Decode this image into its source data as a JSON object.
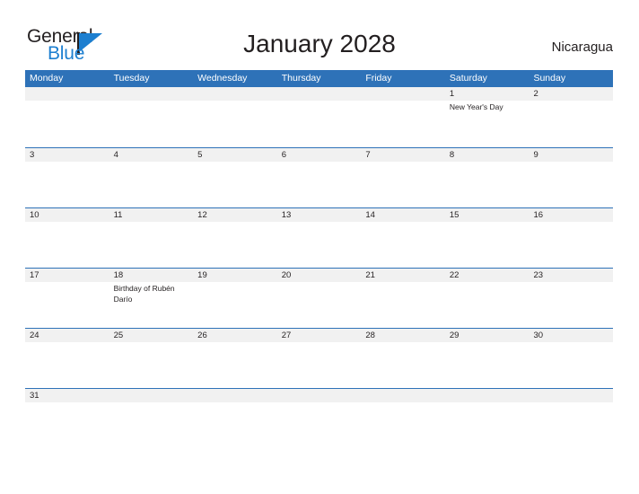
{
  "brand": {
    "word_one": "General",
    "word_two": "Blue",
    "flag_icon": "triangle-flag-icon",
    "accent_blue": "#1d7fd0"
  },
  "header": {
    "title": "January 2028",
    "country": "Nicaragua"
  },
  "colors": {
    "header_blue": "#2e72b8",
    "band_gray": "#f1f1f1",
    "text": "#231f20",
    "page_background": "#ffffff"
  },
  "calendar": {
    "month": "January",
    "year": "2028",
    "day_headers": [
      "Monday",
      "Tuesday",
      "Wednesday",
      "Thursday",
      "Friday",
      "Saturday",
      "Sunday"
    ],
    "weeks": [
      [
        {
          "date": "",
          "events": []
        },
        {
          "date": "",
          "events": []
        },
        {
          "date": "",
          "events": []
        },
        {
          "date": "",
          "events": []
        },
        {
          "date": "",
          "events": []
        },
        {
          "date": "1",
          "events": [
            "New Year's Day"
          ]
        },
        {
          "date": "2",
          "events": []
        }
      ],
      [
        {
          "date": "3",
          "events": []
        },
        {
          "date": "4",
          "events": []
        },
        {
          "date": "5",
          "events": []
        },
        {
          "date": "6",
          "events": []
        },
        {
          "date": "7",
          "events": []
        },
        {
          "date": "8",
          "events": []
        },
        {
          "date": "9",
          "events": []
        }
      ],
      [
        {
          "date": "10",
          "events": []
        },
        {
          "date": "11",
          "events": []
        },
        {
          "date": "12",
          "events": []
        },
        {
          "date": "13",
          "events": []
        },
        {
          "date": "14",
          "events": []
        },
        {
          "date": "15",
          "events": []
        },
        {
          "date": "16",
          "events": []
        }
      ],
      [
        {
          "date": "17",
          "events": []
        },
        {
          "date": "18",
          "events": [
            "Birthday of Rubén Darío"
          ]
        },
        {
          "date": "19",
          "events": []
        },
        {
          "date": "20",
          "events": []
        },
        {
          "date": "21",
          "events": []
        },
        {
          "date": "22",
          "events": []
        },
        {
          "date": "23",
          "events": []
        }
      ],
      [
        {
          "date": "24",
          "events": []
        },
        {
          "date": "25",
          "events": []
        },
        {
          "date": "26",
          "events": []
        },
        {
          "date": "27",
          "events": []
        },
        {
          "date": "28",
          "events": []
        },
        {
          "date": "29",
          "events": []
        },
        {
          "date": "30",
          "events": []
        }
      ],
      [
        {
          "date": "31",
          "events": []
        },
        {
          "date": "",
          "events": []
        },
        {
          "date": "",
          "events": []
        },
        {
          "date": "",
          "events": []
        },
        {
          "date": "",
          "events": []
        },
        {
          "date": "",
          "events": []
        },
        {
          "date": "",
          "events": []
        }
      ]
    ]
  }
}
